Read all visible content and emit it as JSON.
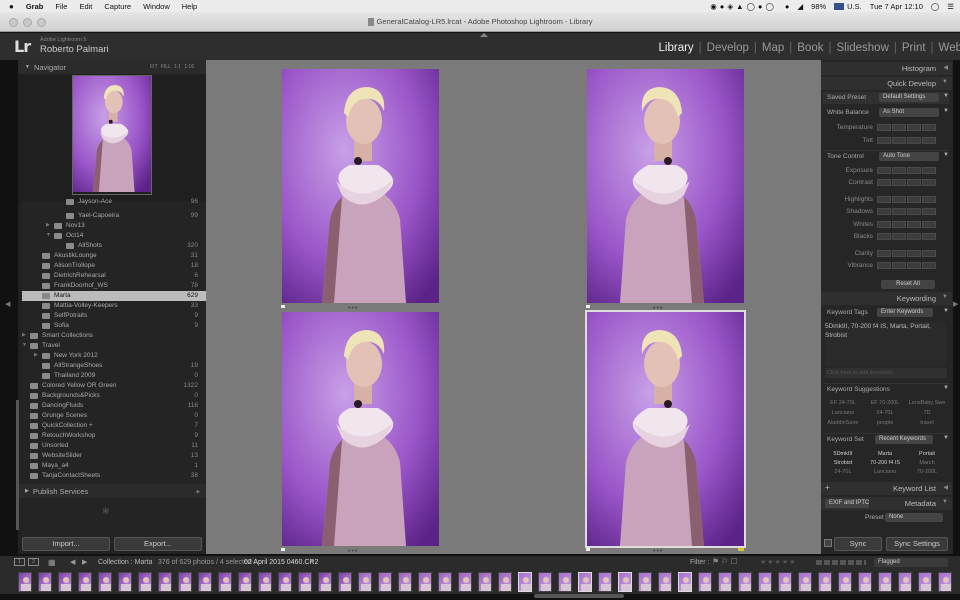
{
  "menubar": {
    "apple": "",
    "items": [
      "Grab",
      "File",
      "Edit",
      "Capture",
      "Window",
      "Help"
    ],
    "battery": "98%",
    "input_source": "U.S.",
    "clock": "Tue 7 Apr  12:10"
  },
  "window": {
    "title": "GeneralCatalog-LR5.lrcat - Adobe Photoshop Lightroom - Library"
  },
  "identity": {
    "logo": "Lr",
    "version": "Adobe Lightroom 5",
    "user": "Roberto Palmari"
  },
  "modules": [
    {
      "label": "Library",
      "active": true
    },
    {
      "label": "Develop"
    },
    {
      "label": "Map"
    },
    {
      "label": "Book"
    },
    {
      "label": "Slideshow"
    },
    {
      "label": "Print"
    },
    {
      "label": "Web"
    }
  ],
  "navigator": {
    "title": "Navigator",
    "zoom_options": [
      "FIT",
      "FILL",
      "1:1",
      "1:16"
    ]
  },
  "folders": [
    {
      "label": "Jayson-Ace",
      "count": "96",
      "depth": 3,
      "cut": true
    },
    {
      "label": "Yael-Capoeira",
      "count": "99",
      "depth": 3
    },
    {
      "label": "Nov13",
      "count": "",
      "depth": 2,
      "tri": "▶"
    },
    {
      "label": "Oct14",
      "count": "",
      "depth": 2,
      "tri": "▼"
    },
    {
      "label": "AllShots",
      "count": "320",
      "depth": 3
    },
    {
      "label": "AkustikLounge",
      "count": "31",
      "depth": 1
    },
    {
      "label": "AlisonTrollope",
      "count": "18",
      "depth": 1
    },
    {
      "label": "DietrichRehearsal",
      "count": "6",
      "depth": 1
    },
    {
      "label": "FrankDoorhof_WS",
      "count": "78",
      "depth": 1
    },
    {
      "label": "Marta",
      "count": "629",
      "depth": 1,
      "selected": true
    },
    {
      "label": "Mattia-Volley-Keepers",
      "count": "33",
      "depth": 1
    },
    {
      "label": "SelfPotraits",
      "count": "9",
      "depth": 1
    },
    {
      "label": "Sofia",
      "count": "9",
      "depth": 1
    },
    {
      "label": "Smart Collections",
      "count": "",
      "depth": 0,
      "tri": "▶"
    },
    {
      "label": "Travel",
      "count": "",
      "depth": 0,
      "tri": "▼"
    },
    {
      "label": "New York 2012",
      "count": "",
      "depth": 1,
      "tri": "▶"
    },
    {
      "label": "AllStrangeShoes",
      "count": "19",
      "depth": 1
    },
    {
      "label": "Thailand 2009",
      "count": "0",
      "depth": 1
    },
    {
      "label": "Colored Yellow OR Green",
      "count": "1322",
      "depth": 0
    },
    {
      "label": "Backgrounds&Picks",
      "count": "0",
      "depth": 0
    },
    {
      "label": "DancingFluids",
      "count": "116",
      "depth": 0
    },
    {
      "label": "Grunge Scenes",
      "count": "0",
      "depth": 0
    },
    {
      "label": "QuickCollection +",
      "count": "7",
      "depth": 0
    },
    {
      "label": "RetouchWorkshop",
      "count": "9",
      "depth": 0
    },
    {
      "label": "Unsorted",
      "count": "11",
      "depth": 0
    },
    {
      "label": "WebsiteSlider",
      "count": "13",
      "depth": 0
    },
    {
      "label": "Maya_a4",
      "count": "1",
      "depth": 0
    },
    {
      "label": "TanjaContactSheets",
      "count": "38",
      "depth": 0
    }
  ],
  "publish_services": {
    "title": "Publish Services",
    "add": "+"
  },
  "left_buttons": {
    "import": "Import...",
    "export": "Export..."
  },
  "right_panel": {
    "histogram": "Histogram",
    "quick_develop": "Quick Develop",
    "saved_preset": {
      "label": "Saved Preset",
      "value": "Default Settings"
    },
    "white_balance": {
      "label": "White Balance",
      "value": "As Shot"
    },
    "temperature": "Temperature",
    "tint": "Tint",
    "tone_control": {
      "label": "Tone Control",
      "value": "Auto Tone"
    },
    "tone_sliders": [
      "Exposure",
      "Contrast",
      "Highlights",
      "Shadows",
      "Whites",
      "Blacks",
      "Clarity",
      "Vibrance"
    ],
    "reset_all": "Reset All",
    "keywording": "Keywording",
    "keyword_tags": {
      "label": "Keyword Tags",
      "value": "Enter Keywords"
    },
    "keywords_text": "5DmkIII, 70-200 f4 IS, Marta, Portait, Strobist",
    "add_keywords_placeholder": "Click here to add keywords",
    "keyword_suggestions": "Keyword Suggestions",
    "suggestions": [
      "EF 24-70L",
      "EF 70-200L",
      "LensBaby Swe",
      "Lanciano",
      "24-70L",
      "7D",
      "AladdinSane",
      "people",
      "travel"
    ],
    "keyword_set": {
      "label": "Keyword Set",
      "value": "Recent Keywords"
    },
    "set_items": [
      "5DmkIII",
      "Marta",
      "Portait",
      "Strobist",
      "70-200 f4 IS",
      "March",
      "24-70L",
      "Lanciano",
      "70-200L"
    ],
    "keyword_list": "Keyword List",
    "metadata": "Metadata",
    "exif_preset": "EXIF and IPTC",
    "preset_label": "Preset",
    "preset_value": "None",
    "sync": "Sync",
    "sync_settings": "Sync Settings"
  },
  "filmbar": {
    "collection": "Collection : Marta",
    "info": "376 of 629 photos / 4 selected /",
    "filename": "02 April 2015 0460.CR2",
    "filter_label": "Filter :",
    "filter_value": "Flagged"
  },
  "colors": {
    "accent_flag": "#d8c23a",
    "selection": "#bcbcbc",
    "panel": "#222222"
  }
}
